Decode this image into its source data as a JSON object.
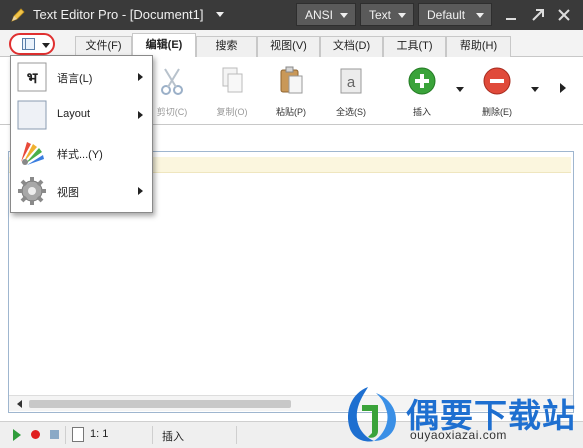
{
  "window": {
    "title": "Text Editor Pro  -  [Document1]",
    "encoding_button": "ANSI",
    "mode_button": "Text",
    "theme_button": "Default"
  },
  "tabs": [
    {
      "label": "文件(F)"
    },
    {
      "label": "编辑(E)",
      "active": true
    },
    {
      "label": "搜索"
    },
    {
      "label": "视图(V)"
    },
    {
      "label": "文档(D)"
    },
    {
      "label": "工具(T)"
    },
    {
      "label": "帮助(H)"
    }
  ],
  "ribbon": {
    "cut": "剪切(C)",
    "copy": "复制(O)",
    "paste": "粘贴(P)",
    "select_all": "全选(S)",
    "insert": "插入",
    "delete": "删除(E)"
  },
  "popup_menu": {
    "items": [
      {
        "label": "语言(L)",
        "icon": "language-icon",
        "submenu": true
      },
      {
        "label": "Layout",
        "icon": "layout-icon",
        "submenu": true
      },
      {
        "label": "样式...(Y)",
        "icon": "palette-icon",
        "submenu": false
      },
      {
        "label": "视图",
        "icon": "gear-icon",
        "submenu": true
      }
    ]
  },
  "status": {
    "position": "1: 1",
    "mode": "插入"
  },
  "watermark": {
    "title": "偶要下载站",
    "url": "ouyaoxiazai.com"
  },
  "colors": {
    "titlebar": "#3a3a3a",
    "highlight_line": "#fbf6de",
    "menu_ring": "#e03030",
    "insert_green": "#3aa33a",
    "delete_red": "#e04a3a",
    "watermark_blue": "#1e6fd0"
  }
}
